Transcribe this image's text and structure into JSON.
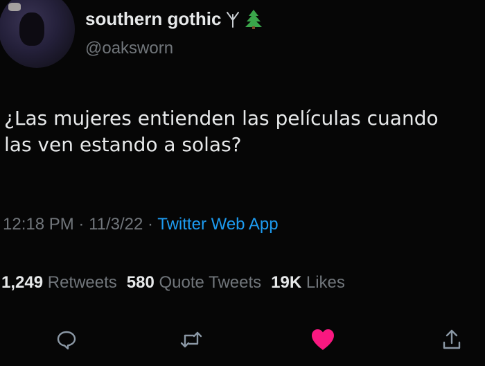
{
  "profile": {
    "display_name": "southern gothic",
    "handle": "@oaksworn",
    "emoji_icons": [
      "rune-algiz-icon",
      "evergreen-tree-icon"
    ],
    "avatar_icon": "avatar"
  },
  "tweet": {
    "text_line1": "¿Las mujeres entienden las películas cuando",
    "text_line2": "las ven estando a solas?"
  },
  "meta": {
    "time": "12:18 PM",
    "sep1": " · ",
    "date": "11/3/22",
    "sep2": " · ",
    "source": "Twitter Web App"
  },
  "stats": {
    "retweets_count": "1,249",
    "retweets_label": "Retweets",
    "quotes_count": "580",
    "quotes_label": "Quote Tweets",
    "likes_count": "19K",
    "likes_label": "Likes"
  },
  "actions": {
    "icons": [
      "reply-icon",
      "retweet-icon",
      "like-icon",
      "share-icon"
    ],
    "like_color": "#f91880",
    "icon_color": "#8b98a5"
  }
}
